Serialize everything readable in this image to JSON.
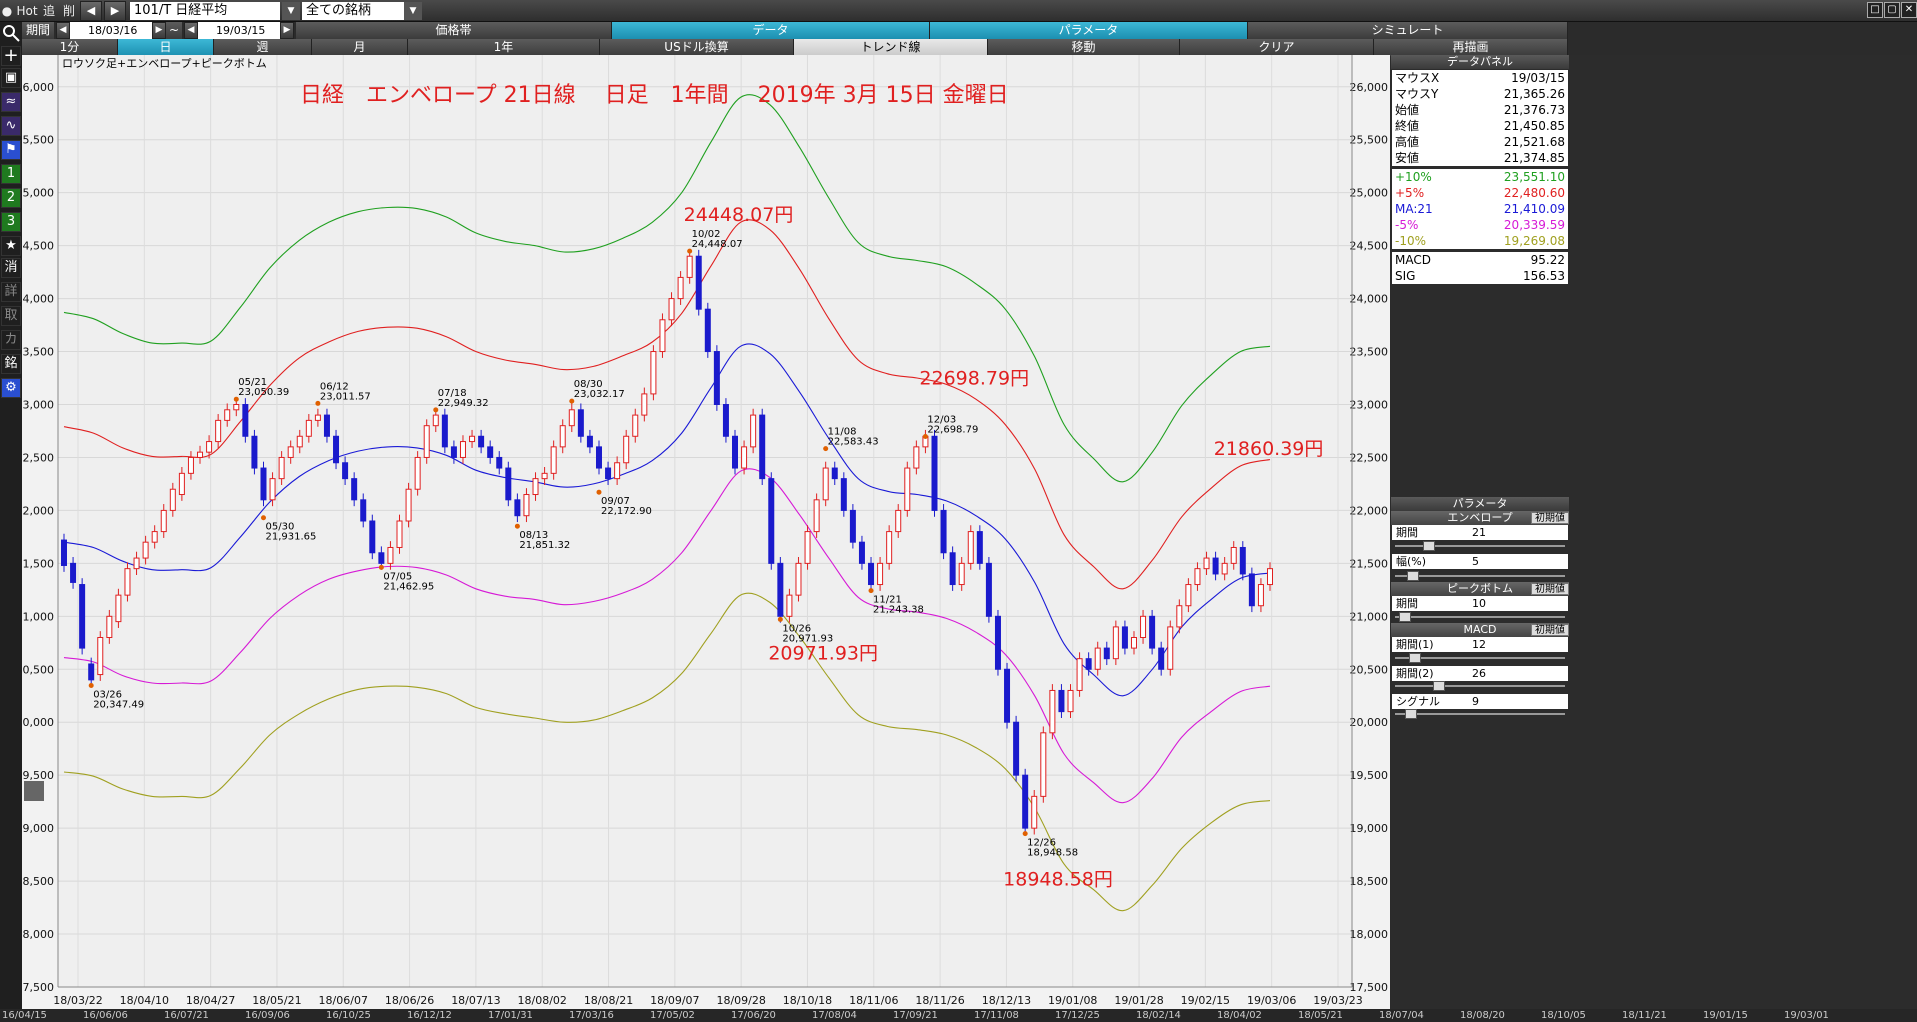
{
  "toolbar": {
    "hot": "Hot",
    "tsui": "追",
    "sakujo": "削",
    "symbol": "101/T 日経平均",
    "universe": "全ての銘柄",
    "kikan_label": "期間",
    "date_from": "18/03/16",
    "date_sep": "~",
    "date_to": "19/03/15"
  },
  "tabs_row1": [
    "価格帯",
    "データ",
    "パラメータ",
    "シミュレート"
  ],
  "tabs_row2": [
    "1分",
    "日",
    "週",
    "月",
    "1年",
    "USドル換算",
    "トレンド線",
    "移動",
    "クリア",
    "再描画"
  ],
  "left_tools": {
    "t1": "1",
    "t2": "2",
    "t3": "3",
    "t4": "消",
    "t5": "詳",
    "t6": "取",
    "t7": "カ",
    "t8": "銘"
  },
  "chart_data": {
    "type": "candlestick",
    "subtitle": "ロウソク足+エンベロープ+ピークボトム",
    "title": "日経　エンベロープ 21日線　 日足　1年間　 2019年 3月 15日 金曜日",
    "yticks": [
      17500,
      18000,
      18500,
      19000,
      19500,
      20000,
      20500,
      21000,
      21500,
      22000,
      22500,
      23000,
      23500,
      24000,
      24500,
      25000,
      25500,
      26000
    ],
    "ylim": [
      17500,
      26300
    ],
    "xticks": [
      "18/03/22",
      "18/04/10",
      "18/04/27",
      "18/05/21",
      "18/06/07",
      "18/06/26",
      "18/07/13",
      "18/08/02",
      "18/08/21",
      "18/09/07",
      "18/09/28",
      "18/10/18",
      "18/11/06",
      "18/11/26",
      "18/12/13",
      "19/01/08",
      "19/01/28",
      "19/02/15",
      "19/03/06",
      "19/03/23"
    ],
    "colors": {
      "up": "#e02020",
      "down": "#1a1acc",
      "ma": "#1a1ad6",
      "p5": "#e02020",
      "m5": "#d61ad6",
      "p10": "#20a020",
      "m10": "#a0a020"
    },
    "ma21": [
      21700,
      21650,
      21520,
      21440,
      21440,
      21460,
      21750,
      22080,
      22320,
      22470,
      22560,
      22600,
      22590,
      22520,
      22380,
      22310,
      22270,
      22220,
      22250,
      22340,
      22470,
      22730,
      23160,
      23550,
      23480,
      23120,
      22680,
      22300,
      22180,
      22150,
      22090,
      21950,
      21730,
      21320,
      20740,
      20450,
      20250,
      20500,
      20900,
      21160,
      21360,
      21410
    ],
    "plus5": [
      22790,
      22730,
      22590,
      22510,
      22510,
      22530,
      22840,
      23180,
      23440,
      23590,
      23690,
      23730,
      23720,
      23640,
      23500,
      23420,
      23380,
      23330,
      23360,
      23460,
      23590,
      23860,
      24310,
      24720,
      24650,
      24280,
      23810,
      23420,
      23290,
      23250,
      23190,
      23050,
      22810,
      22390,
      21770,
      21470,
      21260,
      21530,
      21940,
      22210,
      22420,
      22480
    ],
    "minus5": [
      20610,
      20570,
      20440,
      20370,
      20370,
      20390,
      20660,
      20980,
      21200,
      21350,
      21430,
      21470,
      21460,
      21390,
      21260,
      21190,
      21160,
      21110,
      21140,
      21220,
      21350,
      21600,
      22000,
      22370,
      22310,
      21960,
      21550,
      21180,
      21070,
      21040,
      20980,
      20850,
      20640,
      20250,
      19700,
      19430,
      19240,
      19470,
      19860,
      20100,
      20290,
      20340
    ],
    "plus10": [
      23870,
      23810,
      23670,
      23580,
      23580,
      23600,
      23920,
      24290,
      24550,
      24720,
      24820,
      24860,
      24850,
      24770,
      24620,
      24540,
      24500,
      24440,
      24470,
      24570,
      24720,
      25000,
      25480,
      25900,
      25830,
      25430,
      24950,
      24530,
      24400,
      24360,
      24300,
      24140,
      23900,
      23450,
      22810,
      22490,
      22270,
      22550,
      22990,
      23280,
      23500,
      23550
    ],
    "minus10": [
      19530,
      19490,
      19370,
      19300,
      19300,
      19310,
      19570,
      19880,
      20080,
      20220,
      20310,
      20340,
      20330,
      20270,
      20140,
      20080,
      20040,
      20000,
      20020,
      20110,
      20230,
      20460,
      20840,
      21200,
      21130,
      20810,
      20420,
      20070,
      19960,
      19930,
      19880,
      19760,
      19560,
      19190,
      18660,
      18420,
      18220,
      18460,
      18810,
      19050,
      19220,
      19260
    ],
    "candles": [
      [
        21720,
        21480
      ],
      [
        21500,
        21320
      ],
      [
        21300,
        20700
      ],
      [
        20550,
        20400
      ],
      [
        20450,
        20800
      ],
      [
        20800,
        21000
      ],
      [
        20950,
        21200
      ],
      [
        21200,
        21450
      ],
      [
        21450,
        21550
      ],
      [
        21550,
        21700
      ],
      [
        21700,
        21800
      ],
      [
        21800,
        22000
      ],
      [
        22000,
        22200
      ],
      [
        22150,
        22350
      ],
      [
        22350,
        22500
      ],
      [
        22500,
        22550
      ],
      [
        22550,
        22650
      ],
      [
        22650,
        22850
      ],
      [
        22850,
        22950
      ],
      [
        22950,
        23000
      ],
      [
        23000,
        22700
      ],
      [
        22700,
        22400
      ],
      [
        22400,
        22100
      ],
      [
        22100,
        22300
      ],
      [
        22300,
        22500
      ],
      [
        22500,
        22600
      ],
      [
        22600,
        22700
      ],
      [
        22700,
        22850
      ],
      [
        22850,
        22900
      ],
      [
        22900,
        22700
      ],
      [
        22700,
        22450
      ],
      [
        22450,
        22300
      ],
      [
        22300,
        22100
      ],
      [
        22100,
        21900
      ],
      [
        21900,
        21600
      ],
      [
        21600,
        21500
      ],
      [
        21500,
        21650
      ],
      [
        21650,
        21900
      ],
      [
        21900,
        22200
      ],
      [
        22200,
        22500
      ],
      [
        22500,
        22800
      ],
      [
        22800,
        22900
      ],
      [
        22900,
        22600
      ],
      [
        22600,
        22500
      ],
      [
        22500,
        22650
      ],
      [
        22650,
        22700
      ],
      [
        22700,
        22600
      ],
      [
        22600,
        22500
      ],
      [
        22500,
        22400
      ],
      [
        22400,
        22100
      ],
      [
        22100,
        21950
      ],
      [
        21950,
        22150
      ],
      [
        22150,
        22300
      ],
      [
        22300,
        22350
      ],
      [
        22350,
        22600
      ],
      [
        22600,
        22800
      ],
      [
        22800,
        22950
      ],
      [
        22950,
        22700
      ],
      [
        22700,
        22600
      ],
      [
        22600,
        22400
      ],
      [
        22400,
        22300
      ],
      [
        22300,
        22450
      ],
      [
        22450,
        22700
      ],
      [
        22700,
        22900
      ],
      [
        22900,
        23100
      ],
      [
        23100,
        23500
      ],
      [
        23500,
        23800
      ],
      [
        23800,
        24000
      ],
      [
        24000,
        24200
      ],
      [
        24200,
        24400
      ],
      [
        24400,
        23900
      ],
      [
        23900,
        23500
      ],
      [
        23500,
        23000
      ],
      [
        23000,
        22700
      ],
      [
        22700,
        22400
      ],
      [
        22400,
        22600
      ],
      [
        22600,
        22900
      ],
      [
        22900,
        22300
      ],
      [
        22300,
        21500
      ],
      [
        21500,
        21000
      ],
      [
        21000,
        21200
      ],
      [
        21200,
        21500
      ],
      [
        21500,
        21800
      ],
      [
        21800,
        22100
      ],
      [
        22100,
        22400
      ],
      [
        22400,
        22300
      ],
      [
        22300,
        22000
      ],
      [
        22000,
        21700
      ],
      [
        21700,
        21500
      ],
      [
        21500,
        21300
      ],
      [
        21300,
        21500
      ],
      [
        21500,
        21800
      ],
      [
        21800,
        22000
      ],
      [
        22000,
        22400
      ],
      [
        22400,
        22600
      ],
      [
        22600,
        22700
      ],
      [
        22700,
        22000
      ],
      [
        22000,
        21600
      ],
      [
        21600,
        21300
      ],
      [
        21300,
        21500
      ],
      [
        21500,
        21800
      ],
      [
        21800,
        21500
      ],
      [
        21500,
        21000
      ],
      [
        21000,
        20500
      ],
      [
        20500,
        20000
      ],
      [
        20000,
        19500
      ],
      [
        19500,
        19000
      ],
      [
        19000,
        19300
      ],
      [
        19300,
        19900
      ],
      [
        19900,
        20300
      ],
      [
        20300,
        20100
      ],
      [
        20100,
        20300
      ],
      [
        20300,
        20600
      ],
      [
        20600,
        20500
      ],
      [
        20500,
        20700
      ],
      [
        20700,
        20600
      ],
      [
        20600,
        20900
      ],
      [
        20900,
        20700
      ],
      [
        20700,
        20800
      ],
      [
        20800,
        21000
      ],
      [
        21000,
        20700
      ],
      [
        20700,
        20500
      ],
      [
        20500,
        20900
      ],
      [
        20900,
        21100
      ],
      [
        21100,
        21300
      ],
      [
        21300,
        21450
      ],
      [
        21450,
        21550
      ],
      [
        21550,
        21400
      ],
      [
        21400,
        21500
      ],
      [
        21500,
        21650
      ],
      [
        21650,
        21400
      ],
      [
        21400,
        21100
      ],
      [
        21100,
        21300
      ],
      [
        21300,
        21450
      ]
    ],
    "annotations": [
      {
        "date": "03/26",
        "value": "20,347.49",
        "y": 20347,
        "i": 3,
        "pos": "below"
      },
      {
        "date": "05/21",
        "value": "23,050.39",
        "y": 23050,
        "i": 19,
        "pos": "above"
      },
      {
        "date": "05/30",
        "value": "21,931.65",
        "y": 21931,
        "i": 22,
        "pos": "below"
      },
      {
        "date": "06/12",
        "value": "23,011.57",
        "y": 23011,
        "i": 28,
        "pos": "above"
      },
      {
        "date": "07/05",
        "value": "21,462.95",
        "y": 21462,
        "i": 35,
        "pos": "below"
      },
      {
        "date": "07/18",
        "value": "22,949.32",
        "y": 22949,
        "i": 41,
        "pos": "above"
      },
      {
        "date": "08/13",
        "value": "21,851.32",
        "y": 21851,
        "i": 50,
        "pos": "below"
      },
      {
        "date": "08/30",
        "value": "23,032.17",
        "y": 23032,
        "i": 56,
        "pos": "above"
      },
      {
        "date": "09/07",
        "value": "22,172.90",
        "y": 22172,
        "i": 59,
        "pos": "below"
      },
      {
        "date": "10/02",
        "value": "24,448.07",
        "y": 24448,
        "i": 69,
        "pos": "above"
      },
      {
        "date": "10/26",
        "value": "20,971.93",
        "y": 20971,
        "i": 79,
        "pos": "below"
      },
      {
        "date": "11/08",
        "value": "22,583.43",
        "y": 22583,
        "i": 84,
        "pos": "above"
      },
      {
        "date": "11/21",
        "value": "21,243.38",
        "y": 21243,
        "i": 89,
        "pos": "below"
      },
      {
        "date": "12/03",
        "value": "22,698.79",
        "y": 22698,
        "i": 95,
        "pos": "above"
      },
      {
        "date": "12/26",
        "value": "18,948.58",
        "y": 18948,
        "i": 106,
        "pos": "below"
      }
    ],
    "big_labels": [
      {
        "text": "24448.07円",
        "y": 24448,
        "i": 69
      },
      {
        "text": "22698.79円",
        "y": 22698,
        "i": 95
      },
      {
        "text": "20971.93円",
        "y": 20971,
        "i": 79
      },
      {
        "text": "18948.58円",
        "y": 18948,
        "i": 106
      },
      {
        "text": "21860.39円",
        "y": 21860,
        "i": 129
      }
    ]
  },
  "data_panel": {
    "title": "データパネル",
    "rows": [
      {
        "k": "マウスX",
        "v": "19/03/15",
        "c": "#000"
      },
      {
        "k": "マウスY",
        "v": "21,365.26",
        "c": "#000"
      },
      {
        "k": "始値",
        "v": "21,376.73",
        "c": "#000"
      },
      {
        "k": "終値",
        "v": "21,450.85",
        "c": "#000"
      },
      {
        "k": "高値",
        "v": "21,521.68",
        "c": "#000"
      },
      {
        "k": "安値",
        "v": "21,374.85",
        "c": "#000"
      },
      {
        "k": "+10%",
        "v": "23,551.10",
        "c": "#20a020"
      },
      {
        "k": "+5%",
        "v": "22,480.60",
        "c": "#e02020"
      },
      {
        "k": "MA:21",
        "v": "21,410.09",
        "c": "#1a1ad6"
      },
      {
        "k": "-5%",
        "v": "20,339.59",
        "c": "#d61ad6"
      },
      {
        "k": "-10%",
        "v": "19,269.08",
        "c": "#a0a020"
      },
      {
        "k": "MACD",
        "v": "95.22",
        "c": "#000"
      },
      {
        "k": "SIG",
        "v": "156.53",
        "c": "#000"
      }
    ]
  },
  "param_panel": {
    "title": "パラメータ",
    "reset": "初期値",
    "envelope": {
      "title": "エンベロープ",
      "period_label": "期間",
      "period": "21",
      "width_label": "幅(%)",
      "width": "5"
    },
    "peakbottom": {
      "title": "ピークボトム",
      "period_label": "期間",
      "period": "10"
    },
    "macd": {
      "title": "MACD",
      "p1_label": "期間(1)",
      "p1": "12",
      "p2_label": "期間(2)",
      "p2": "26",
      "sig_label": "シグナル",
      "sig": "9"
    }
  },
  "bottom_dates": [
    "16/04/15",
    "16/06/06",
    "16/07/21",
    "16/09/06",
    "16/10/25",
    "16/12/12",
    "17/01/31",
    "17/03/16",
    "17/05/02",
    "17/06/20",
    "17/08/04",
    "17/09/21",
    "17/11/08",
    "17/12/25",
    "18/02/14",
    "18/04/02",
    "18/05/21",
    "18/07/04",
    "18/08/20",
    "18/10/05",
    "18/11/21",
    "19/01/15",
    "19/03/01"
  ]
}
